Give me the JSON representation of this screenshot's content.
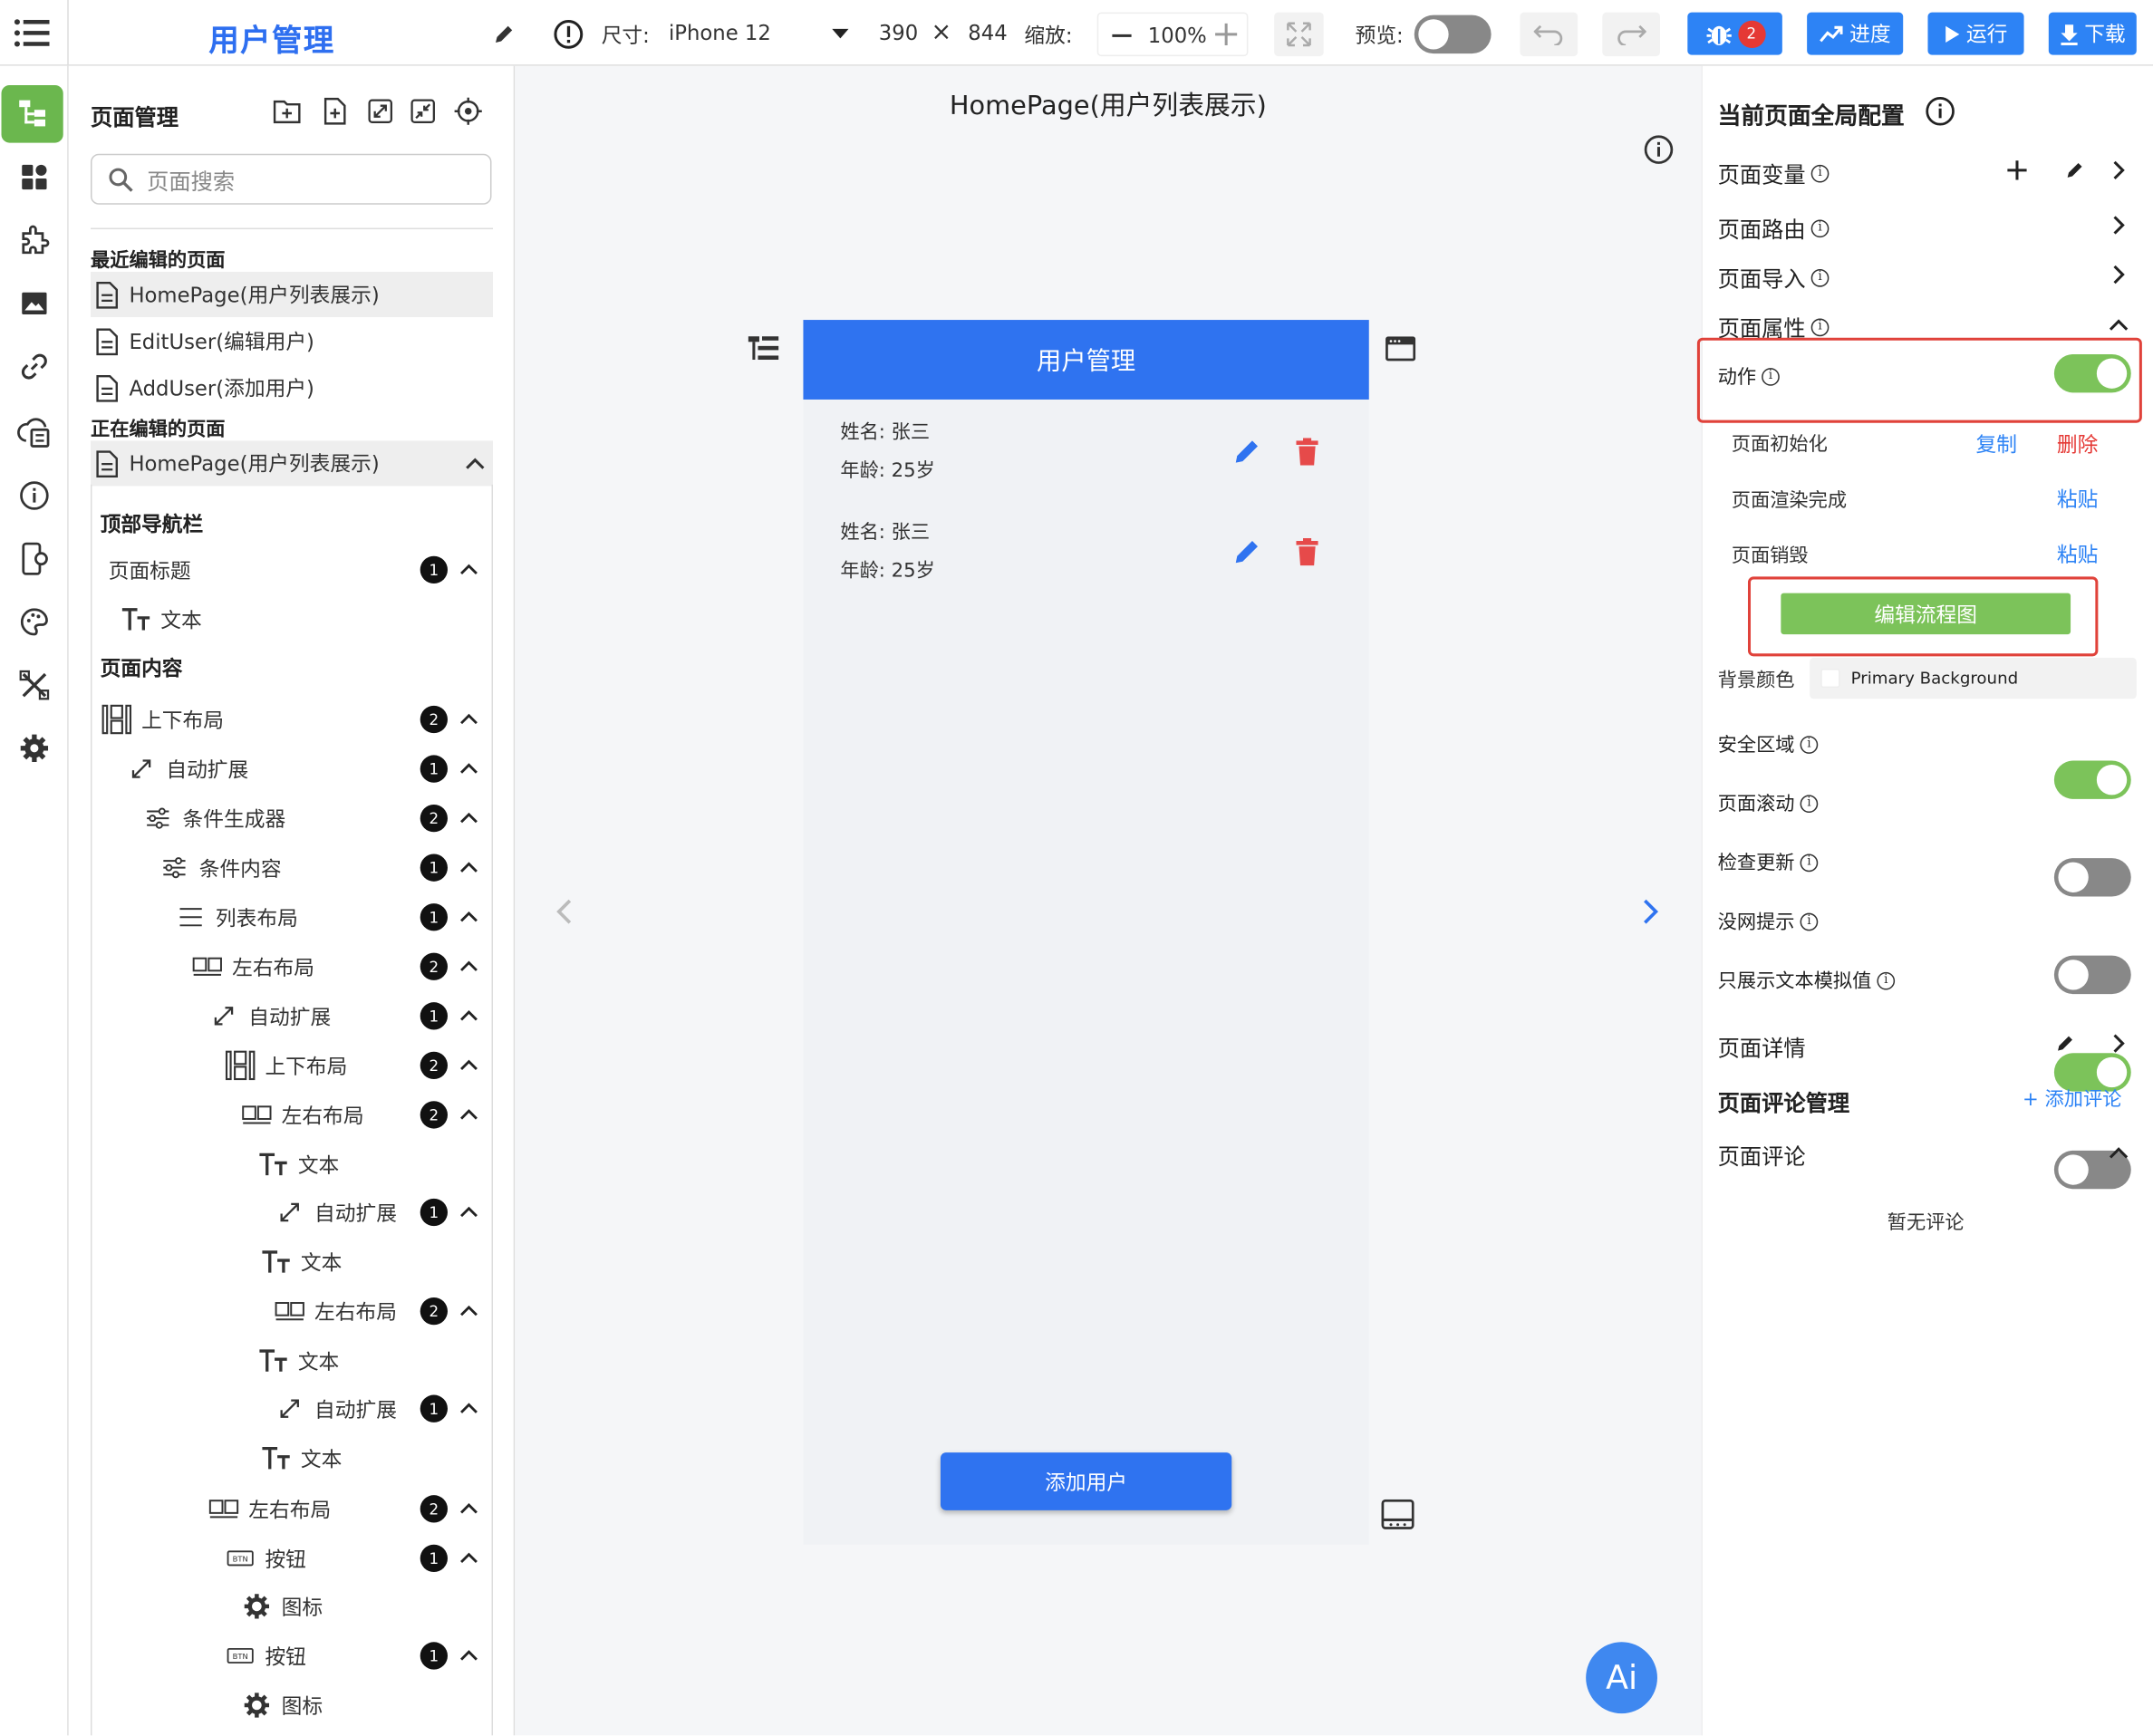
{
  "topbar": {
    "title": "用户管理",
    "size_label": "尺寸:",
    "device": "iPhone 12",
    "width": "390",
    "times": "×",
    "height": "844",
    "zoom_label": "缩放:",
    "zoom_value": "100%",
    "preview_label": "预览:",
    "bug_count": "2",
    "progress_label": "进度",
    "run_label": "运行",
    "download_label": "下载"
  },
  "left_panel": {
    "title": "页面管理",
    "search_placeholder": "页面搜索",
    "recent_title": "最近编辑的页面",
    "recent_pages": [
      "HomePage(用户列表展示)",
      "EditUser(编辑用户)",
      "AddUser(添加用户)"
    ],
    "editing_title": "正在编辑的页面",
    "editing_page": "HomePage(用户列表展示)",
    "tree": [
      {
        "type": "header",
        "label": "顶部导航栏"
      },
      {
        "label": "页面标题",
        "icon": "none",
        "count": "1"
      },
      {
        "label": "文本",
        "icon": "text-icon"
      },
      {
        "type": "header",
        "label": "页面内容"
      },
      {
        "label": "上下布局",
        "icon": "column-layout-icon",
        "count": "2"
      },
      {
        "label": "自动扩展",
        "icon": "expand-icon",
        "count": "1"
      },
      {
        "label": "条件生成器",
        "icon": "sliders-icon",
        "count": "2"
      },
      {
        "label": "条件内容",
        "icon": "sliders-icon",
        "count": "1"
      },
      {
        "label": "列表布局",
        "icon": "list-layout-icon",
        "count": "1"
      },
      {
        "label": "左右布局",
        "icon": "row-layout-icon",
        "count": "2"
      },
      {
        "label": "自动扩展",
        "icon": "expand-icon",
        "count": "1"
      },
      {
        "label": "上下布局",
        "icon": "column-layout-icon",
        "count": "2"
      },
      {
        "label": "左右布局",
        "icon": "row-layout-icon",
        "count": "2"
      },
      {
        "label": "文本",
        "icon": "text-icon"
      },
      {
        "label": "自动扩展",
        "icon": "expand-icon",
        "count": "1"
      },
      {
        "label": "文本",
        "icon": "text-icon"
      },
      {
        "label": "左右布局",
        "icon": "row-layout-icon",
        "count": "2"
      },
      {
        "label": "文本",
        "icon": "text-icon"
      },
      {
        "label": "自动扩展",
        "icon": "expand-icon",
        "count": "1"
      },
      {
        "label": "文本",
        "icon": "text-icon"
      },
      {
        "label": "左右布局",
        "icon": "row-layout-icon",
        "count": "2"
      },
      {
        "label": "按钮",
        "icon": "button-icon",
        "count": "1"
      },
      {
        "label": "图标",
        "icon": "gear-icon"
      },
      {
        "label": "按钮",
        "icon": "button-icon",
        "count": "1"
      },
      {
        "label": "图标",
        "icon": "gear-icon"
      }
    ]
  },
  "canvas": {
    "page_title": "HomePage(用户列表展示)",
    "app_header": "用户管理",
    "users": [
      {
        "name_line": "姓名:  张三",
        "age_line": "年龄:  25岁"
      },
      {
        "name_line": "姓名:  张三",
        "age_line": "年龄:  25岁"
      }
    ],
    "add_button": "添加用户",
    "ai_button": "Ai"
  },
  "right_panel": {
    "title": "当前页面全局配置",
    "page_vars": "页面变量",
    "page_route": "页面路由",
    "page_import": "页面导入",
    "page_props": "页面属性",
    "action_label": "动作",
    "events": [
      {
        "label": "页面初始化",
        "actions": [
          "复制",
          "删除"
        ]
      },
      {
        "label": "页面渲染完成",
        "actions": [
          "粘贴"
        ]
      },
      {
        "label": "页面销毁",
        "actions": [
          "粘贴"
        ]
      }
    ],
    "edit_flow": "编辑流程图",
    "bg_label": "背景颜色",
    "bg_value": "Primary Background",
    "toggles": [
      {
        "label": "安全区域",
        "on": true
      },
      {
        "label": "页面滚动",
        "on": false
      },
      {
        "label": "检查更新",
        "on": false
      },
      {
        "label": "没网提示",
        "on": true
      },
      {
        "label": "只展示文本模拟值",
        "on": false
      }
    ],
    "page_details": "页面详情",
    "comment_mgmt": "页面评论管理",
    "add_comment": "+ 添加评论",
    "comments": "页面评论",
    "no_comments": "暂无评论"
  },
  "colors": {
    "accent": "#2f73f0",
    "green": "#7cc35a",
    "red": "#e0423a"
  }
}
